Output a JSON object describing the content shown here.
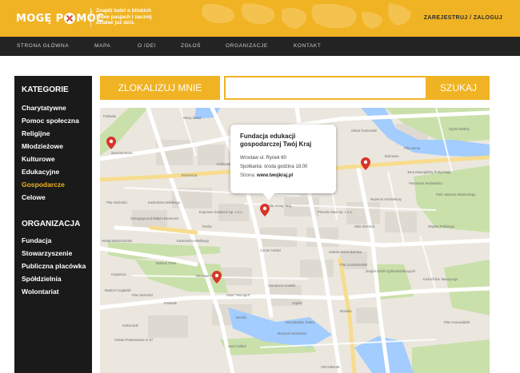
{
  "header": {
    "logo_left": "MOGĘ P",
    "logo_right": "MÓC",
    "tagline": [
      "Znajdź ludzi o bliskich",
      "Tobie pasjach i zacznij",
      "działać już dziś."
    ],
    "auth_link": "ZAREJESTRUJ / ZALOGUJ"
  },
  "nav": {
    "items": [
      "STRONA GŁÓWNA",
      "MAPA",
      "O IDEI",
      "ZGŁOŚ",
      "ORGANIZACJE",
      "KONTAKT"
    ]
  },
  "sidebar": {
    "categories_heading": "KATEGORIE",
    "categories": [
      "Charytatywne",
      "Pomoc społeczna",
      "Religijne",
      "Młodzieżowe",
      "Kulturowe",
      "Edukacyjne",
      "Gospodarcze",
      "Celowe"
    ],
    "active_category": "Gospodarcze",
    "organizations_heading": "ORGANIZACJA",
    "organizations": [
      "Fundacja",
      "Stowarzyszenie",
      "Publiczna placówka",
      "Spółdzielnia",
      "Wolontariat"
    ]
  },
  "search": {
    "locate_label": "ZLOKALIZUJ MNIE",
    "input_value": "",
    "search_label": "SZUKAJ"
  },
  "map": {
    "popup": {
      "title_line1": "Fundacja edukacji",
      "title_line2": "gospodarczej Twój Kraj",
      "address": "Wrocław ul. Rynek 60",
      "meetings": "Spotkania: środa godzina 18.00",
      "website_label": "Strona:",
      "website_value": "www.twojkraj.pl"
    },
    "labels": {
      "l1": "Nowy Świat",
      "l2": "Zwierzyniecka",
      "l3": "Królewska",
      "l4": "Hostel Mieszczański",
      "l5": "Synagoga pod Białym Bocianem",
      "l6": "Expresso Solutions Sp. z o.o.",
      "l7": "Kazimierza Wielkiego",
      "l8": "Boksuk Trans",
      "l9": "Hotel \"Monopol\"",
      "l10": "Szkoła Podstawowa nr 67",
      "l11": "Cinnamon Hostels",
      "l12": "Corner Hostel",
      "l13": "Galeria Dominikańska",
      "l14": "Zespół Szkół Ogólnokształcących",
      "l15": "Kościół Św. Maurycego",
      "l16": "Park Juliusza Słowackiego",
      "l17": "Muzeum Architektury",
      "l18": "Panorama Racławicka",
      "l19": "Plac Bema",
      "l20": "Oskar Gumowski",
      "l21": "Biuroweo",
      "l22": "Jana Ewangelisty Purkyniego",
      "l23": "Plac Nowy Targ",
      "l24": "Phoenix Maxi Sp. z o.o.",
      "l25": "Wita Stwosza",
      "l26": "Piaskowa",
      "l27": "Kazimierza Wielkiego",
      "l28": "Plac Wolności",
      "l29": "Podwale",
      "l30": "Ogród Wodny",
      "l31": "Wojska Polskiego",
      "l32": "Rzeźnicza",
      "l33": "Ruska",
      "l34": "Bozdla",
      "l35": "Podwale",
      "l36": "Plac Dominikański",
      "l37": "Wrocławskie Teatry",
      "l38": "Muzeum Narodowe",
      "l39": "Plac Wolności",
      "l40": "Krupnicza",
      "l41": "Wrocław Opera",
      "l42": "Bastion Ceglarski",
      "l43": "Szpital",
      "l44": "Bramka",
      "l45": "Hotel Sofitel",
      "l46": "Plac Grunwaldzki",
      "l47": "Kościuszki",
      "l48": "ARCHIWUM"
    }
  },
  "colors": {
    "accent": "#f0b323",
    "nav_bg": "#232323",
    "sidebar_bg": "#1a1a1a",
    "active": "#f0b323",
    "pin": "#d8342c"
  }
}
